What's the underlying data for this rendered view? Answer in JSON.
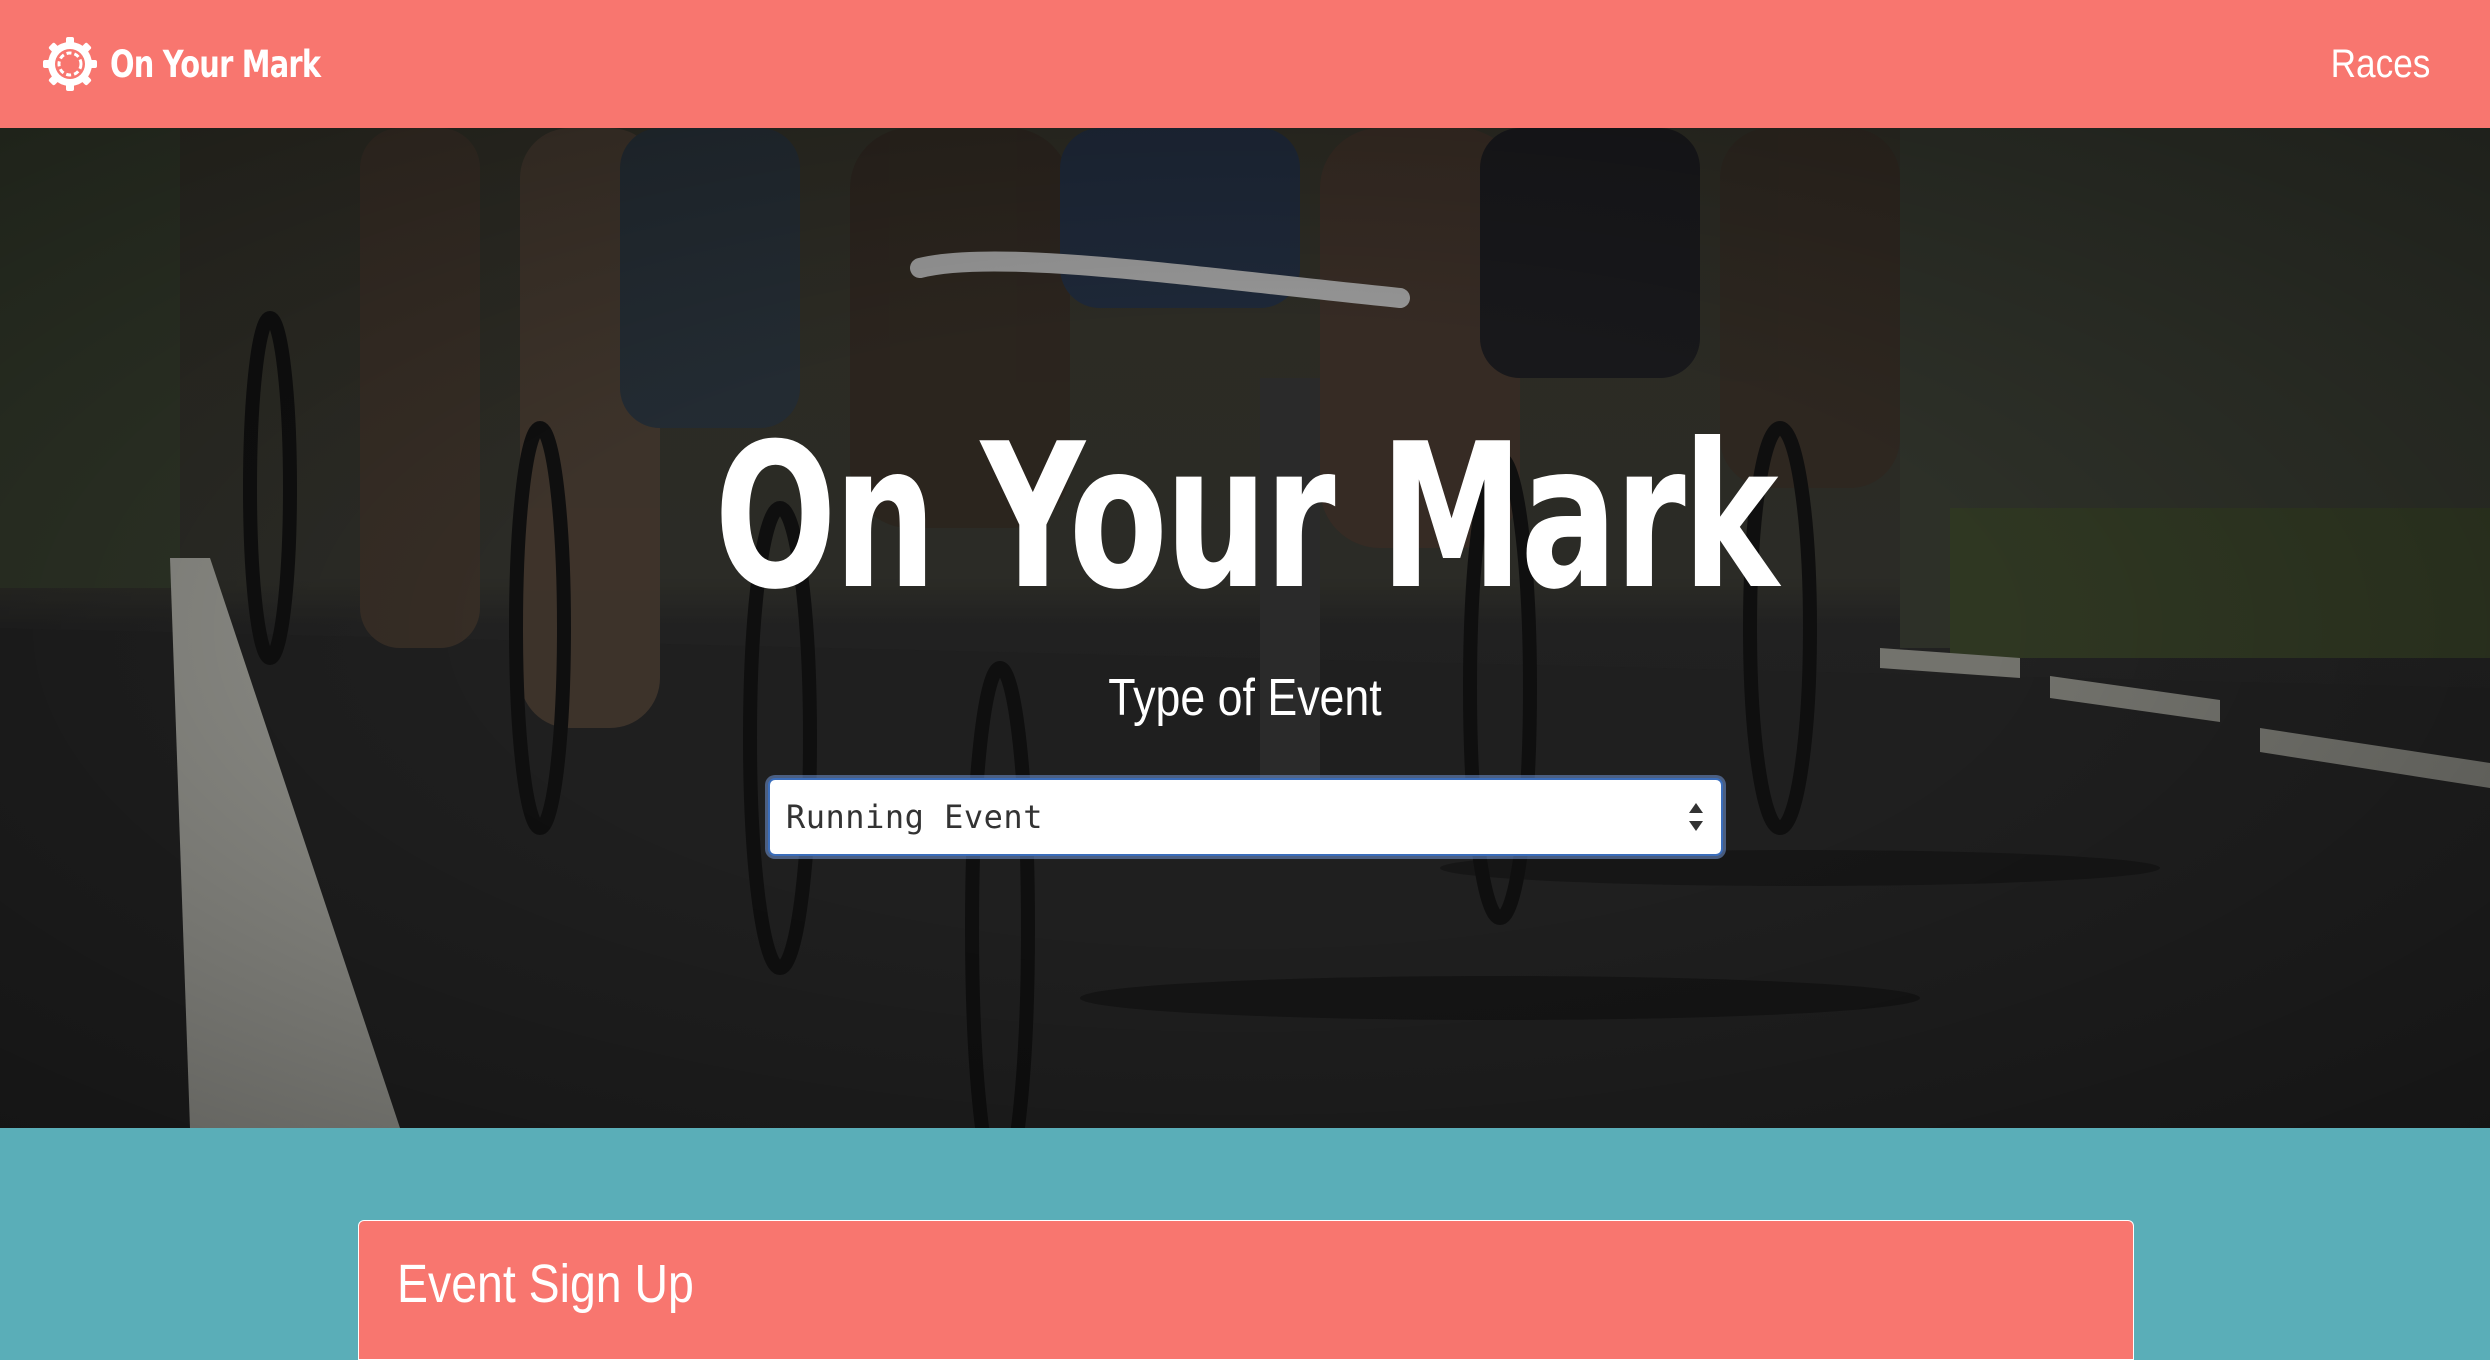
{
  "navbar": {
    "brand_name": "On Your Mark",
    "logo_icon": "gear-icon",
    "links": [
      {
        "label": "Races"
      }
    ]
  },
  "hero": {
    "title": "On Your Mark",
    "subtitle": "Type of Event",
    "event_type_select": {
      "selected": "Running Event",
      "arrows_icon": "select-arrows-icon"
    },
    "background": "cyclists-racing-photo"
  },
  "signup_card": {
    "title": "Event Sign Up"
  },
  "colors": {
    "primary_coral": "#f8766f",
    "teal": "#5aaeb8",
    "white": "#ffffff",
    "select_border": "#3a6dbb"
  }
}
